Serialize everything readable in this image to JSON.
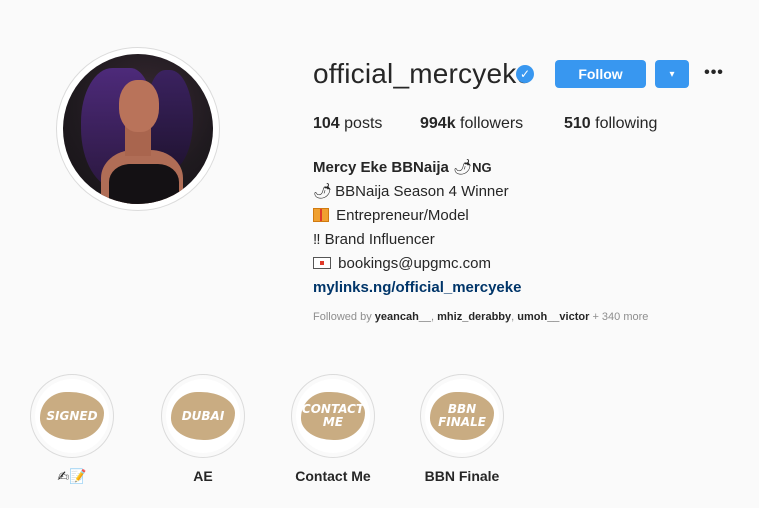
{
  "profile": {
    "username": "official_mercyeke",
    "verified_icon": "verified-badge-icon",
    "follow_label": "Follow",
    "dropdown_icon": "▾",
    "more_icon": "•••"
  },
  "stats": {
    "posts_count": "104",
    "posts_label": "posts",
    "followers_count": "994k",
    "followers_label": "followers",
    "following_count": "510",
    "following_label": "following"
  },
  "bio": {
    "name": "Mercy Eke BBNaija",
    "name_suffix": "NG",
    "line1": "BBNaija Season 4 Winner",
    "line2": "Entrepreneur/Model",
    "line3_prefix": "‼",
    "line3": "Brand Influencer",
    "line4": "bookings@upgmc.com",
    "link": "mylinks.ng/official_mercyeke"
  },
  "followed_by": {
    "prefix": "Followed by",
    "user1": "yeancah__",
    "user2": "mhiz_derabby",
    "user3": "umoh__victor",
    "more": "+ 340 more"
  },
  "highlights": [
    {
      "cover_text": "SIGNED",
      "label": "✍📝"
    },
    {
      "cover_text": "DUBAI",
      "label": "AE"
    },
    {
      "cover_text": "CONTACT ME",
      "label": "Contact Me"
    },
    {
      "cover_text": "BBN FINALE",
      "label": "BBN Finale"
    }
  ],
  "colors": {
    "accent": "#3897f0",
    "link": "#003569",
    "highlight_cover": "#c9ac82",
    "background": "#fafafa"
  }
}
